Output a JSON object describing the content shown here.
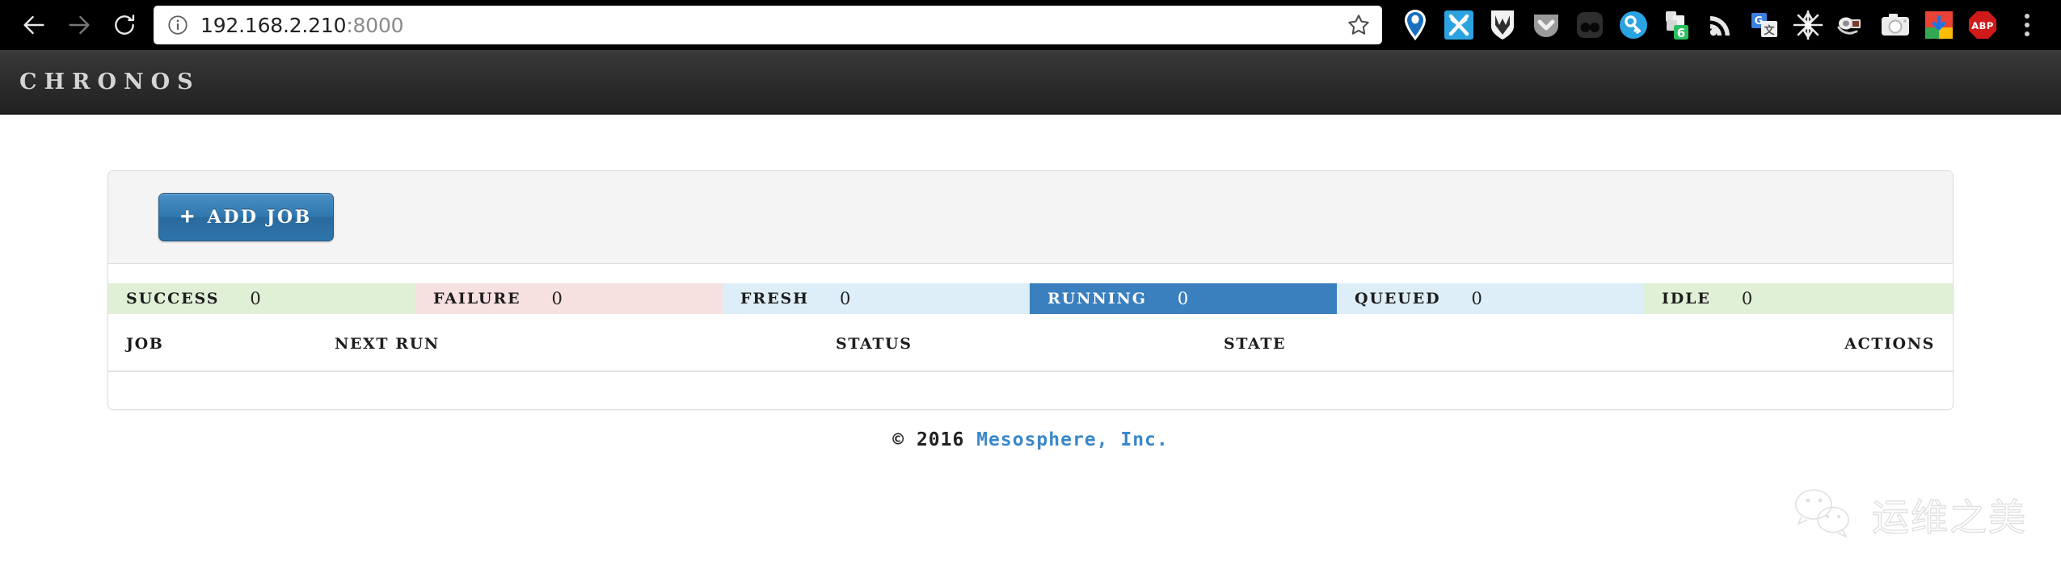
{
  "browser": {
    "back_label": "Back",
    "forward_label": "Forward",
    "reload_label": "Reload",
    "url": "192.168.2.210",
    "url_port": ":8000",
    "url_full": "192.168.2.210:8000",
    "info_icon": "info-circle-icon",
    "star_icon": "bookmark-star-icon",
    "menu_icon": "chrome-menu-icon",
    "extensions": [
      {
        "name": "location-pin-extension",
        "badge": ""
      },
      {
        "name": "x-butterfly-extension",
        "badge": ""
      },
      {
        "name": "shield-m-extension",
        "badge": ""
      },
      {
        "name": "pocket-chevron-extension",
        "badge": ""
      },
      {
        "name": "two-dots-extension",
        "badge": ""
      },
      {
        "name": "key-password-extension",
        "badge": ""
      },
      {
        "name": "evernote-extension",
        "badge": "6"
      },
      {
        "name": "rss-feed-extension",
        "badge": ""
      },
      {
        "name": "google-translate-extension",
        "badge": ""
      },
      {
        "name": "starburst-extension",
        "badge": ""
      },
      {
        "name": "video-camera-extension",
        "badge": ""
      },
      {
        "name": "camera-capture-extension",
        "badge": ""
      },
      {
        "name": "chrome-download-extension",
        "badge": ""
      },
      {
        "name": "adblock-plus-extension",
        "badge": "ABP"
      }
    ]
  },
  "app": {
    "brand": "CHRONOS"
  },
  "toolbar": {
    "add_job_plus": "+",
    "add_job_label": "ADD JOB"
  },
  "status_bar": {
    "segments": [
      {
        "name": "SUCCESS",
        "count": "0",
        "bg": "#dff0d6",
        "active": false
      },
      {
        "name": "FAILURE",
        "count": "0",
        "bg": "#f7e0e0",
        "active": false
      },
      {
        "name": "FRESH",
        "count": "0",
        "bg": "#ddeef8",
        "active": false
      },
      {
        "name": "RUNNING",
        "count": "0",
        "bg": "#3a7fbe",
        "active": true
      },
      {
        "name": "QUEUED",
        "count": "0",
        "bg": "#ddeef8",
        "active": false
      },
      {
        "name": "IDLE",
        "count": "0",
        "bg": "#dff0d6",
        "active": false
      }
    ]
  },
  "jobs_table": {
    "headers": {
      "job": "JOB",
      "next_run": "NEXT RUN",
      "status": "STATUS",
      "state": "STATE",
      "actions": "ACTIONS"
    },
    "rows": []
  },
  "footer": {
    "copyright": "© 2016 ",
    "company": "Mesosphere, Inc."
  },
  "watermark": {
    "icon": "wechat-icon",
    "text": "运维之美"
  },
  "colors": {
    "accent_blue": "#3a7fbe",
    "link_blue": "#3a87c8",
    "header_dark": "#2b2b2b",
    "panel_toolbar": "#f4f4f4",
    "success_bg": "#dff0d6",
    "failure_bg": "#f7e0e0",
    "info_bg": "#ddeef8"
  }
}
